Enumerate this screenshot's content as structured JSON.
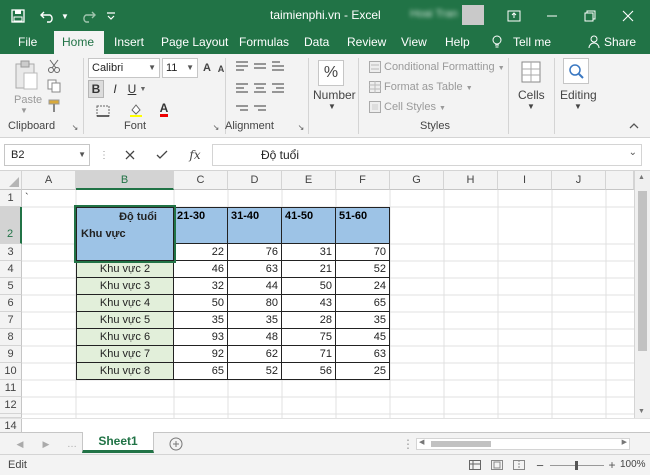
{
  "window": {
    "title": "taimienphi.vn  -  Excel",
    "user": "Hoai Tran"
  },
  "tabs": [
    "File",
    "Home",
    "Insert",
    "Page Layout",
    "Formulas",
    "Data",
    "Review",
    "View",
    "Help",
    "Tell me",
    "Share"
  ],
  "ribbon": {
    "clipboard": {
      "paste": "Paste",
      "label": "Clipboard"
    },
    "font": {
      "name": "Calibri",
      "size": "11",
      "label": "Font",
      "bold": "B",
      "italic": "I",
      "underline": "U"
    },
    "alignment": {
      "label": "Alignment"
    },
    "number": {
      "label": "Number"
    },
    "styles": {
      "conditional": "Conditional Formatting",
      "table": "Format as Table",
      "cell": "Cell Styles",
      "label": "Styles"
    },
    "cells": {
      "label": "Cells"
    },
    "editing": {
      "label": "Editing"
    }
  },
  "formula_bar": {
    "name_box": "B2",
    "fx": "fx",
    "content": "Độ tuổi"
  },
  "columns": [
    "A",
    "B",
    "C",
    "D",
    "E",
    "F",
    "G",
    "H",
    "I",
    "J"
  ],
  "rows": [
    "1",
    "2",
    "3",
    "4",
    "5",
    "6",
    "7",
    "8",
    "9",
    "10",
    "11",
    "12",
    "13",
    "14"
  ],
  "cells": {
    "A1": "`",
    "B2_top": "Độ tuổi",
    "B2_bottom": "Khu vực",
    "C2": "21-30",
    "D2": "31-40",
    "E2": "41-50",
    "F2": "51-60"
  },
  "table": [
    {
      "label": "",
      "values": [
        "22",
        "76",
        "31",
        "70"
      ]
    },
    {
      "label": "Khu vực 2",
      "values": [
        "46",
        "63",
        "21",
        "52"
      ]
    },
    {
      "label": "Khu vực 3",
      "values": [
        "32",
        "44",
        "50",
        "24"
      ]
    },
    {
      "label": "Khu vực 4",
      "values": [
        "50",
        "80",
        "43",
        "65"
      ]
    },
    {
      "label": "Khu vực 5",
      "values": [
        "35",
        "35",
        "28",
        "35"
      ]
    },
    {
      "label": "Khu vực 6",
      "values": [
        "93",
        "48",
        "75",
        "45"
      ]
    },
    {
      "label": "Khu vực 7",
      "values": [
        "92",
        "62",
        "71",
        "63"
      ]
    },
    {
      "label": "Khu vực 8",
      "values": [
        "65",
        "52",
        "56",
        "25"
      ]
    }
  ],
  "sheet": {
    "name": "Sheet1"
  },
  "status": {
    "mode": "Edit",
    "zoom": "100%"
  },
  "colors": {
    "excel_green": "#217346",
    "header_blue": "#9dc3e6",
    "label_green": "#e2efda"
  }
}
